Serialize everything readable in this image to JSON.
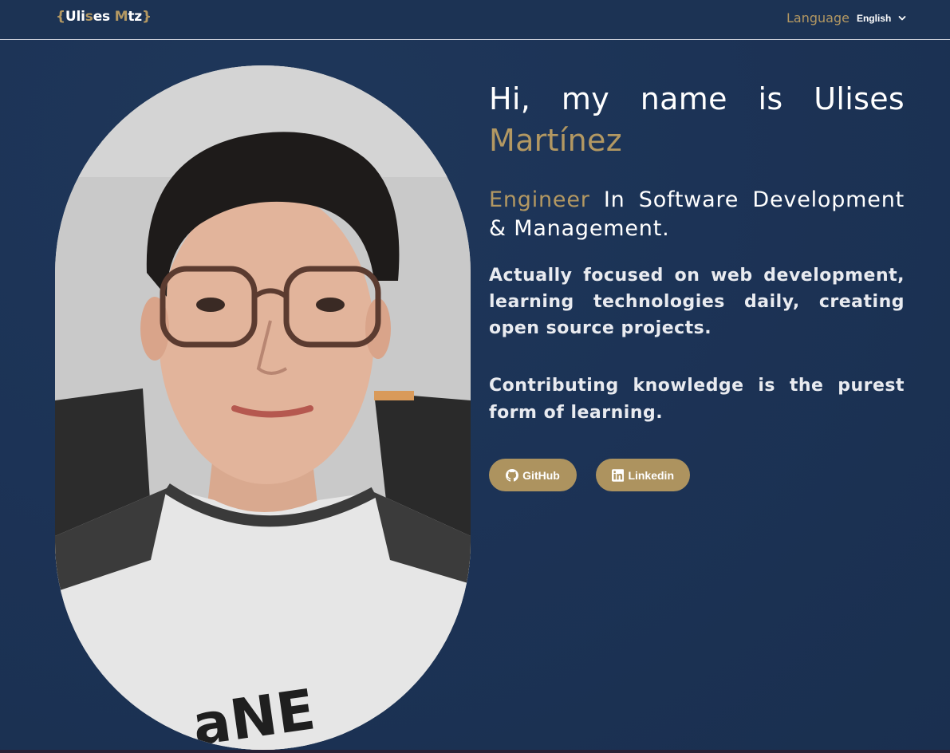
{
  "navbar": {
    "brand": {
      "open_brace": "{",
      "part1": "Uli",
      "part2": "s",
      "part3": "es ",
      "part4": "M",
      "part5": "tz",
      "close_brace": "}"
    },
    "language_label": "Language",
    "language_selected": "English"
  },
  "hero": {
    "greeting": "Hi, my name is Ulises",
    "surname": "Martínez",
    "role_highlight": "Engineer",
    "role_rest": " In Software Development & Management.",
    "description": "Actually focused on web development, learning technologies daily, creating open source projects.",
    "quote": "Contributing knowledge is the purest form of learning.",
    "buttons": {
      "github_label": "GitHub",
      "linkedin_label": "Linkedin"
    }
  },
  "colors": {
    "background": "#1c3356",
    "accent": "#b39862",
    "button": "#ad935f"
  },
  "icons": [
    "github-icon",
    "linkedin-icon",
    "chevron-down-icon"
  ]
}
